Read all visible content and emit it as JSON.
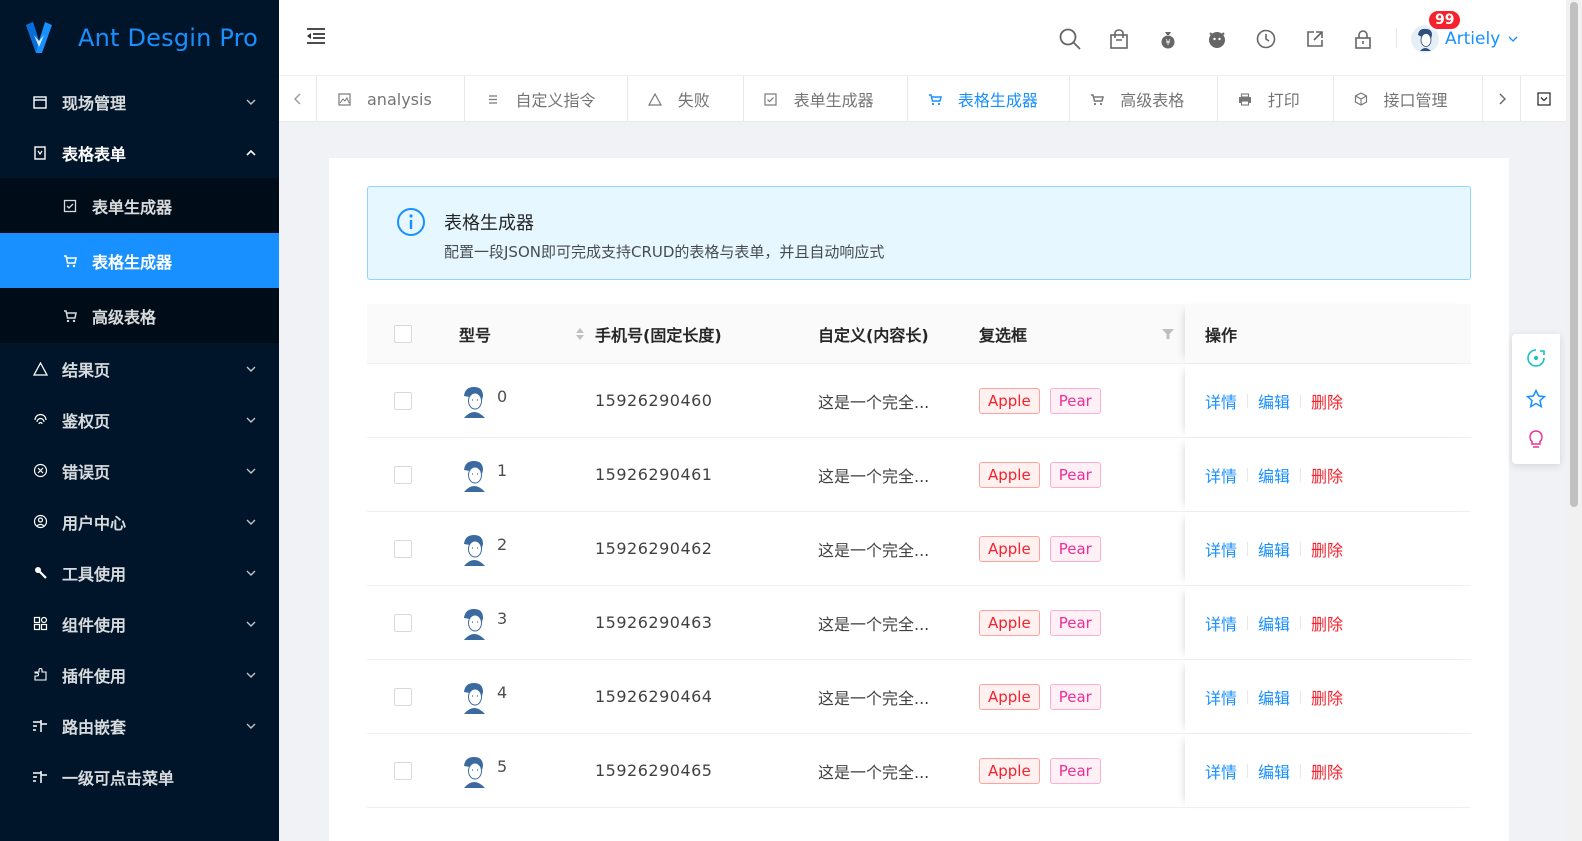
{
  "app": {
    "title": "Ant Desgin Pro"
  },
  "sidebar": {
    "items": [
      {
        "label": "现场管理",
        "icon": "calendar-icon",
        "expanded": false
      },
      {
        "label": "表格表单",
        "icon": "form-icon",
        "expanded": true,
        "children": [
          {
            "label": "表单生成器",
            "icon": "checklist-icon",
            "active": false
          },
          {
            "label": "表格生成器",
            "icon": "cart-icon",
            "active": true
          },
          {
            "label": "高级表格",
            "icon": "cart-icon",
            "active": false
          }
        ]
      },
      {
        "label": "结果页",
        "icon": "warning-icon",
        "expanded": false
      },
      {
        "label": "鉴权页",
        "icon": "fingerprint-icon",
        "expanded": false
      },
      {
        "label": "错误页",
        "icon": "close-circle-icon",
        "expanded": false
      },
      {
        "label": "用户中心",
        "icon": "user-icon",
        "expanded": false
      },
      {
        "label": "工具使用",
        "icon": "tool-icon",
        "expanded": false
      },
      {
        "label": "组件使用",
        "icon": "components-icon",
        "expanded": false
      },
      {
        "label": "插件使用",
        "icon": "plugin-icon",
        "expanded": false
      },
      {
        "label": "路由嵌套",
        "icon": "route-icon",
        "expanded": false
      },
      {
        "label": "一级可点击菜单",
        "icon": "route-icon",
        "expanded": null
      }
    ]
  },
  "header": {
    "icons": [
      "search-icon",
      "shopping-bag-icon",
      "money-bag-icon",
      "github-icon",
      "clock-icon",
      "external-link-icon",
      "lock-icon"
    ],
    "user": {
      "name": "Artiely",
      "badge": "99"
    }
  },
  "tabs": {
    "items": [
      {
        "label": "analysis",
        "icon": "image-icon",
        "active": false
      },
      {
        "label": "自定义指令",
        "icon": "list-icon",
        "active": false
      },
      {
        "label": "失败",
        "icon": "warning-icon",
        "active": false
      },
      {
        "label": "表单生成器",
        "icon": "checklist-icon",
        "active": false
      },
      {
        "label": "表格生成器",
        "icon": "cart-icon",
        "active": true
      },
      {
        "label": "高级表格",
        "icon": "cart-icon",
        "active": false
      },
      {
        "label": "打印",
        "icon": "printer-icon",
        "active": false
      },
      {
        "label": "接口管理",
        "icon": "api-icon",
        "active": false
      }
    ]
  },
  "alert": {
    "title": "表格生成器",
    "description": "配置一段JSON即可完成支持CRUD的表格与表单，并且自动响应式"
  },
  "table": {
    "columns": {
      "model": "型号",
      "phone": "手机号(固定长度)",
      "custom": "自定义(内容长)",
      "checkbox": "复选框",
      "ops": "操作"
    },
    "rows": [
      {
        "model": "0",
        "phone": "15926290460",
        "custom": "这是一个完全...",
        "tags": [
          "Apple",
          "Pear"
        ]
      },
      {
        "model": "1",
        "phone": "15926290461",
        "custom": "这是一个完全...",
        "tags": [
          "Apple",
          "Pear"
        ]
      },
      {
        "model": "2",
        "phone": "15926290462",
        "custom": "这是一个完全...",
        "tags": [
          "Apple",
          "Pear"
        ]
      },
      {
        "model": "3",
        "phone": "15926290463",
        "custom": "这是一个完全...",
        "tags": [
          "Apple",
          "Pear"
        ]
      },
      {
        "model": "4",
        "phone": "15926290464",
        "custom": "这是一个完全...",
        "tags": [
          "Apple",
          "Pear"
        ]
      },
      {
        "model": "5",
        "phone": "15926290465",
        "custom": "这是一个完全...",
        "tags": [
          "Apple",
          "Pear"
        ]
      }
    ],
    "actions": {
      "detail": "详情",
      "edit": "编辑",
      "delete": "删除"
    }
  },
  "colors": {
    "primary": "#1890ff",
    "sider": "#001529",
    "danger": "#f5222d",
    "magenta": "#eb2f96"
  }
}
